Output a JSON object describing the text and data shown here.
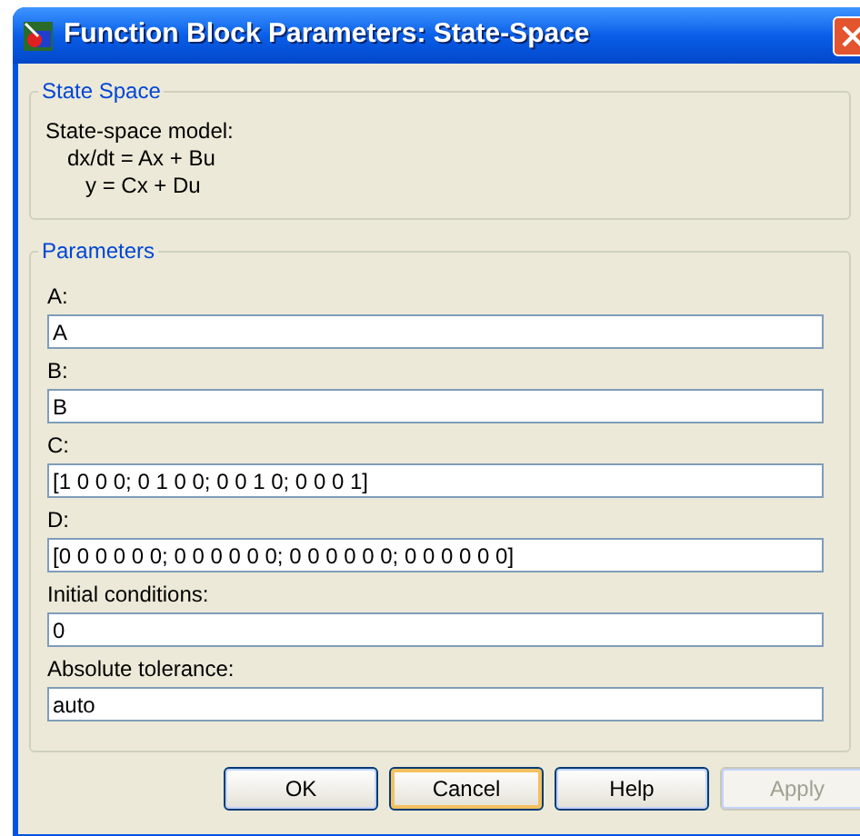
{
  "window": {
    "title": "Function Block Parameters: State-Space"
  },
  "description": {
    "heading": "State Space",
    "lines": [
      "State-space model:",
      "dx/dt = Ax + Bu",
      "y = Cx + Du"
    ]
  },
  "parameters": {
    "heading": "Parameters",
    "fields": [
      {
        "label": "A:",
        "value": "A"
      },
      {
        "label": "B:",
        "value": "B"
      },
      {
        "label": "C:",
        "value": "[1 0 0 0; 0 1 0 0; 0 0 1 0; 0 0 0 1]"
      },
      {
        "label": "D:",
        "value": "[0 0 0 0 0 0; 0 0 0 0 0 0; 0 0 0 0 0 0; 0 0 0 0 0 0]"
      },
      {
        "label": "Initial conditions:",
        "value": "0"
      },
      {
        "label": "Absolute tolerance:",
        "value": "auto"
      }
    ]
  },
  "buttons": [
    {
      "label": "OK",
      "focused": false,
      "disabled": false
    },
    {
      "label": "Cancel",
      "focused": true,
      "disabled": false
    },
    {
      "label": "Help",
      "focused": false,
      "disabled": false
    },
    {
      "label": "Apply",
      "focused": false,
      "disabled": true
    }
  ]
}
